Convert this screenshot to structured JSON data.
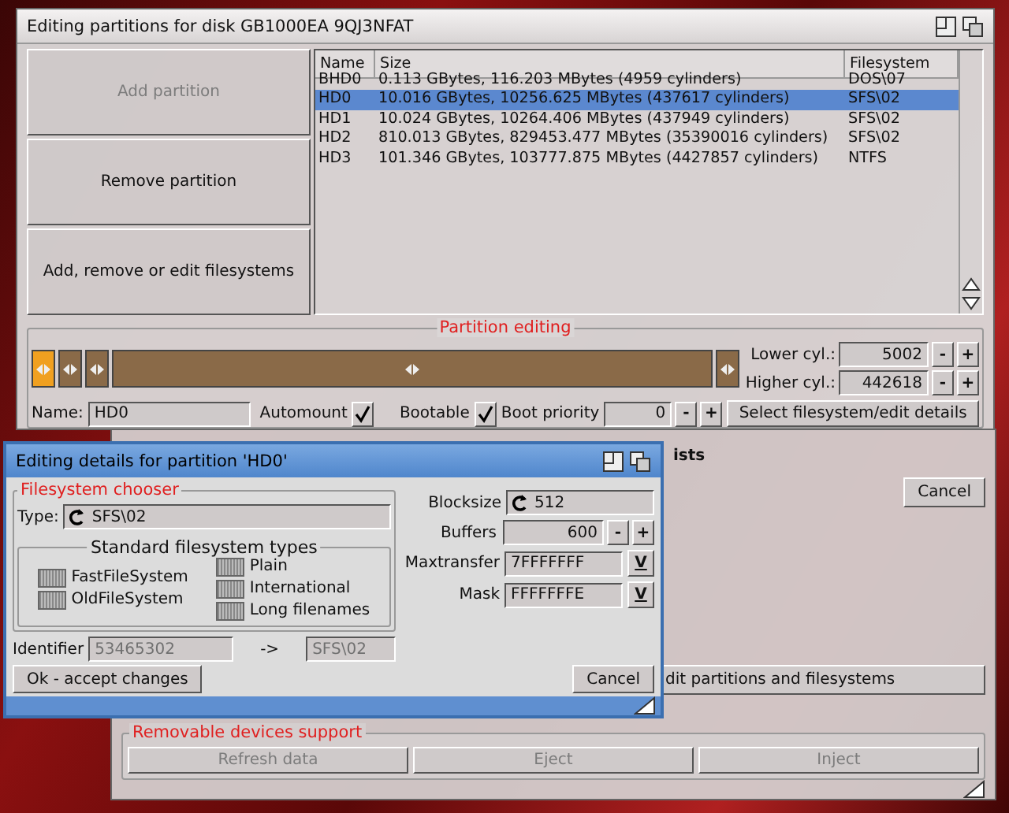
{
  "partition_window": {
    "title": "Editing partitions for disk GB1000EA 9QJ3NFAT",
    "actions": [
      {
        "label": "Add partition",
        "disabled": true
      },
      {
        "label": "Remove partition",
        "disabled": false
      },
      {
        "label": "Add, remove or edit filesystems",
        "disabled": false
      }
    ],
    "table": {
      "columns": [
        "Name",
        "Size",
        "Filesystem"
      ],
      "rows": [
        {
          "cells": [
            "BHD0",
            "0.113 GBytes, 116.203 MBytes (4959 cylinders)",
            "DOS\\07"
          ],
          "selected": false
        },
        {
          "cells": [
            "HD0",
            "10.016 GBytes, 10256.625 MBytes (437617 cylinders)",
            "SFS\\02"
          ],
          "selected": true
        },
        {
          "cells": [
            "HD1",
            "10.024 GBytes, 10264.406 MBytes (437949 cylinders)",
            "SFS\\02"
          ],
          "selected": false
        },
        {
          "cells": [
            "HD2",
            "810.013 GBytes, 829453.477 MBytes (35390016 cylinders)",
            "SFS\\02"
          ],
          "selected": false
        },
        {
          "cells": [
            "HD3",
            "101.346 GBytes, 103777.875 MBytes (4427857 cylinders)",
            "NTFS"
          ],
          "selected": false
        }
      ]
    },
    "section_title": "Partition editing",
    "partition_bar": {
      "segments": [
        {
          "selected": true
        },
        {
          "selected": false
        },
        {
          "selected": false
        },
        {
          "selected": false
        }
      ]
    },
    "lower_cyl": {
      "label": "Lower cyl.:",
      "value": "5002",
      "decrement": "-",
      "increment": "+"
    },
    "higher_cyl": {
      "label": "Higher cyl.:",
      "value": "442618",
      "decrement": "-",
      "increment": "+"
    },
    "name": {
      "label": "Name:",
      "value": "HD0"
    },
    "automount": {
      "label": "Automount",
      "checked": true
    },
    "bootable": {
      "label": "Bootable",
      "checked": true
    },
    "boot_priority": {
      "label": "Boot priority",
      "value": "0",
      "decrement": "-",
      "increment": "+"
    },
    "select_button": "Select filesystem/edit details"
  },
  "background_window": {
    "profiles_text": "ists",
    "cancel": "Cancel",
    "edit_button": "dit partitions and filesystems",
    "removable": {
      "title": "Removable devices support",
      "buttons": [
        {
          "label": "Refresh data",
          "disabled": true
        },
        {
          "label": "Eject",
          "disabled": true
        },
        {
          "label": "Inject",
          "disabled": true
        }
      ]
    }
  },
  "details_dialog": {
    "title": "Editing details for partition 'HD0'",
    "chooser_title": "Filesystem chooser",
    "type": {
      "label": "Type:",
      "value": "SFS\\02"
    },
    "types_title": "Standard filesystem types",
    "left_types": [
      "FastFileSystem",
      "OldFileSystem"
    ],
    "right_types": [
      "Plain",
      "International",
      "Long filenames"
    ],
    "identifier": {
      "label": "Identifier",
      "value": "53465302",
      "arrow": "->",
      "result": "SFS\\02",
      "disabled": true
    },
    "blocksize": {
      "label": "Blocksize",
      "value": "512"
    },
    "buffers": {
      "label": "Buffers",
      "value": "600",
      "decrement": "-",
      "increment": "+"
    },
    "maxtransfer": {
      "label": "Maxtransfer",
      "value": "7FFFFFFF",
      "button": "V"
    },
    "mask": {
      "label": "Mask",
      "value": "FFFFFFFE",
      "button": "V"
    },
    "ok": "Ok - accept changes",
    "cancel": "Cancel"
  }
}
